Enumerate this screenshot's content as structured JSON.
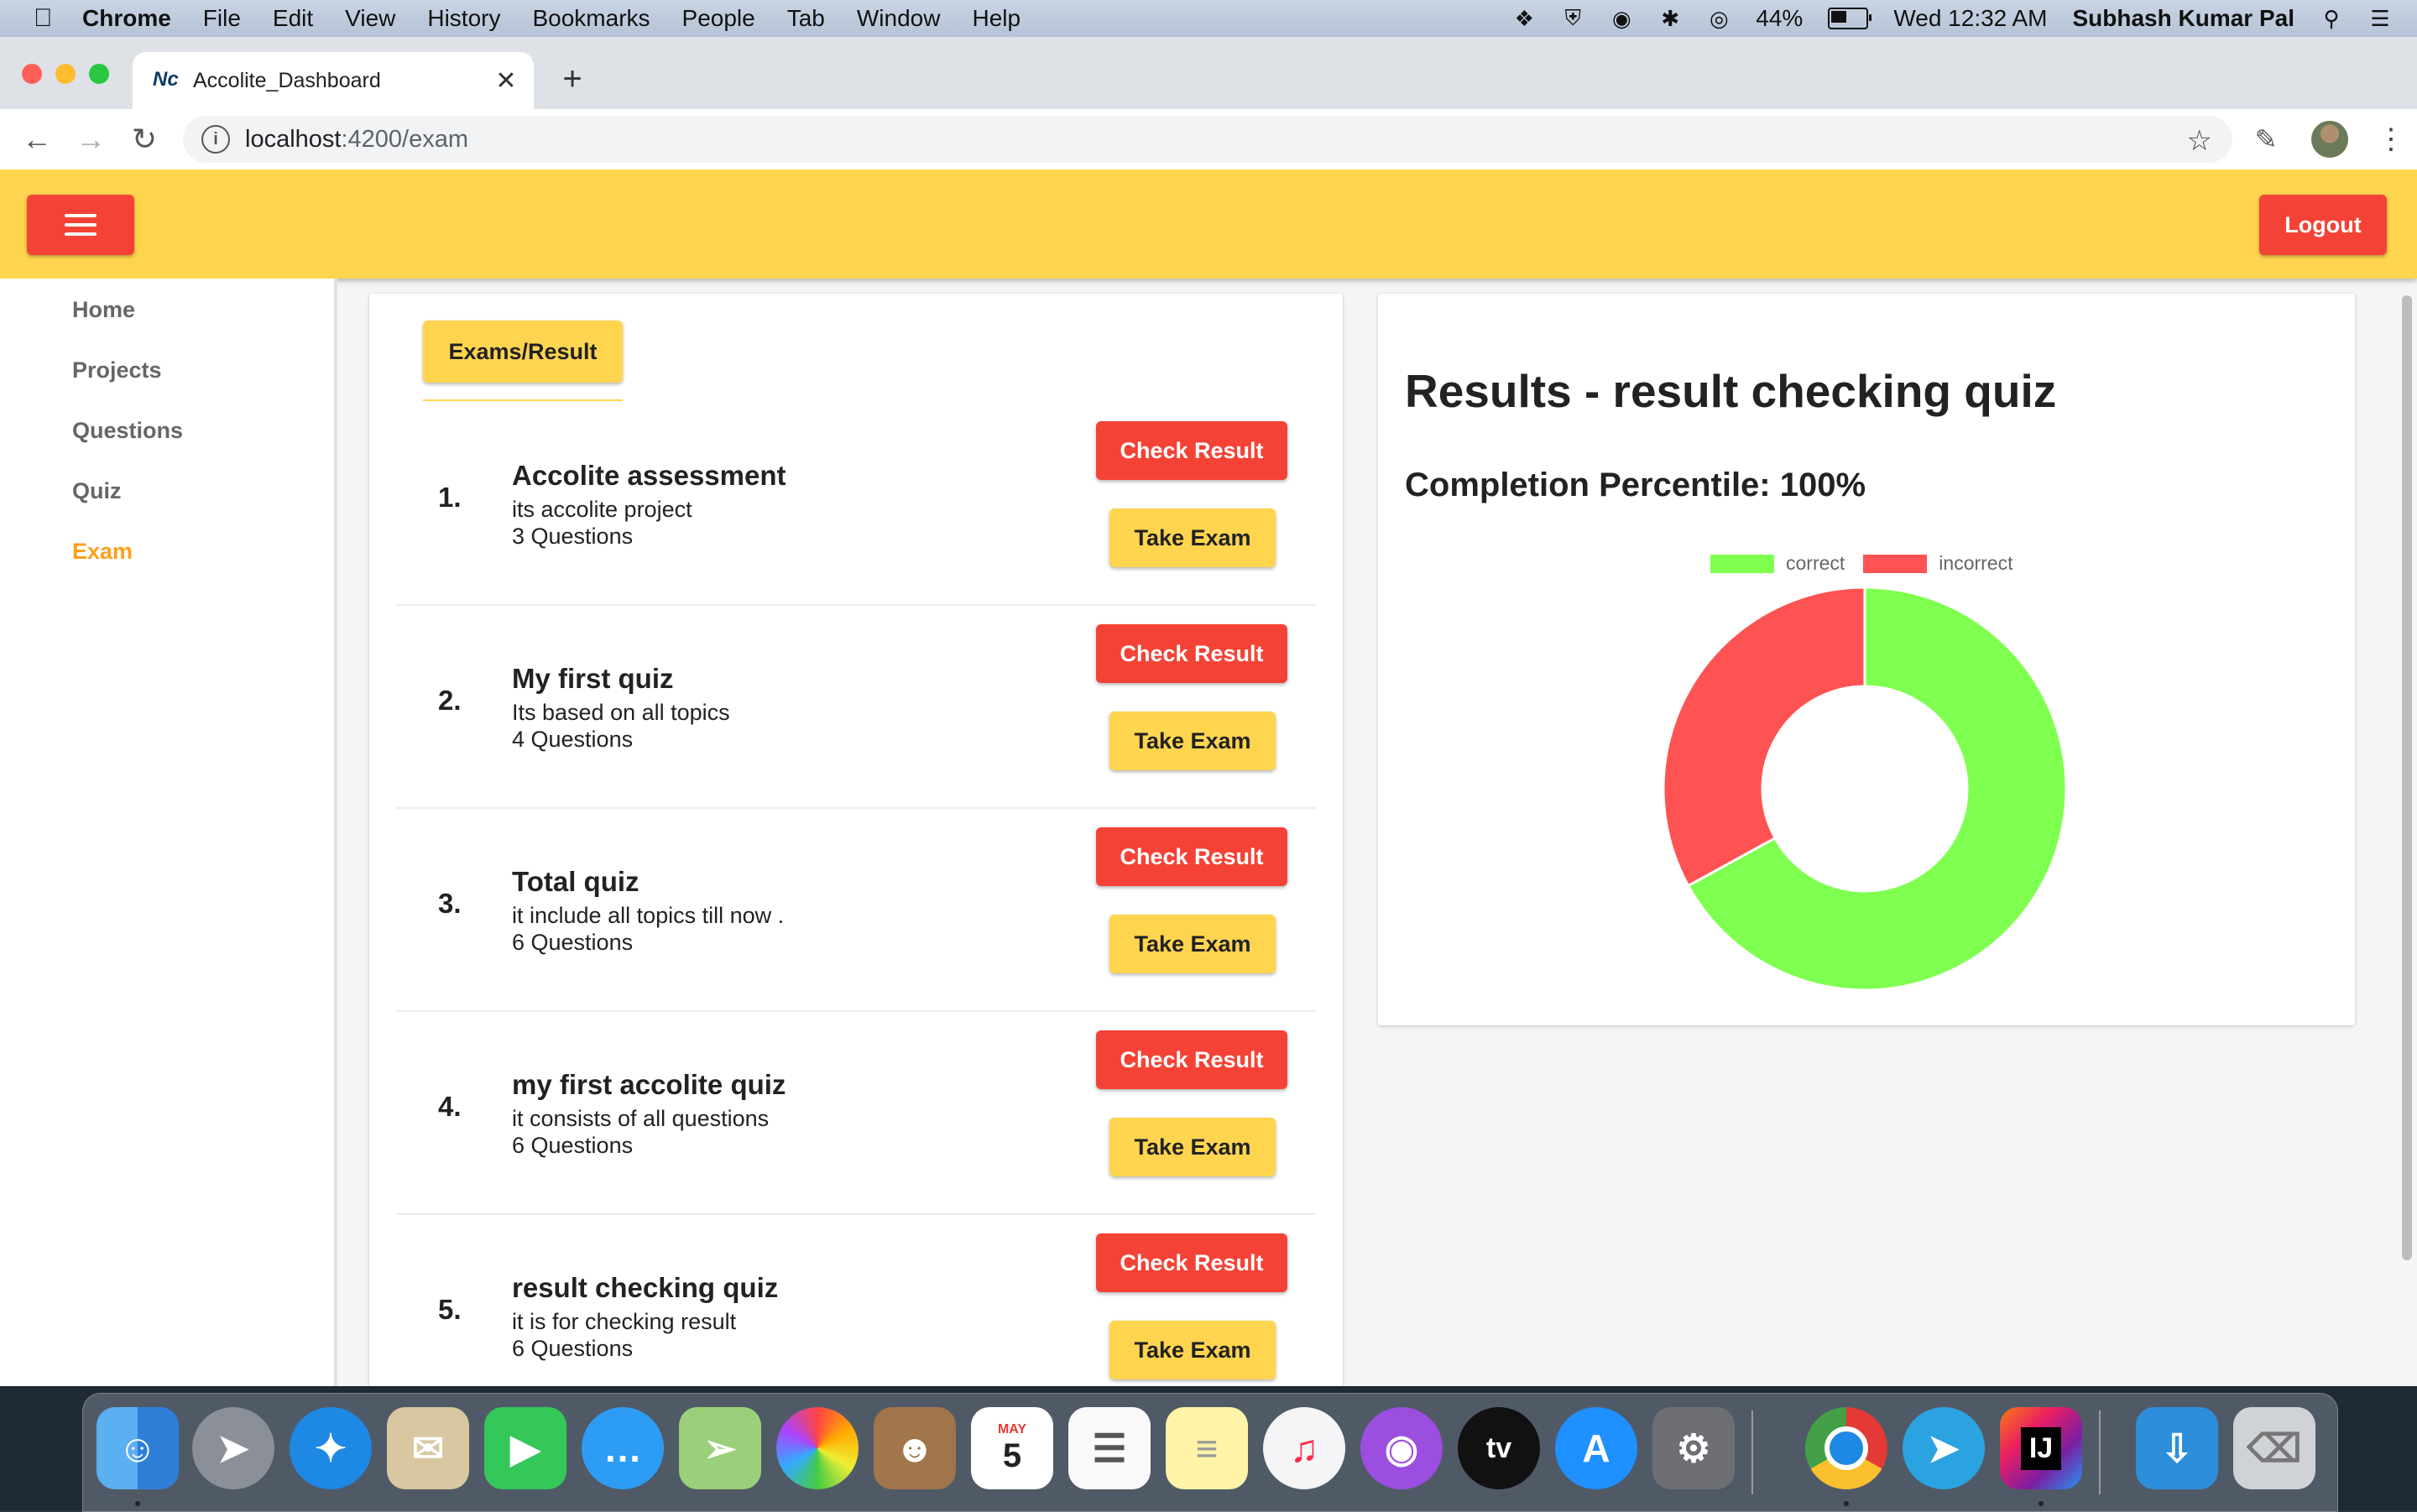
{
  "menubar": {
    "items": [
      "Chrome",
      "File",
      "Edit",
      "View",
      "History",
      "Bookmarks",
      "People",
      "Tab",
      "Window",
      "Help"
    ],
    "battery_percent": "44%",
    "battery_level": 0.44,
    "clock": "Wed 12:32 AM",
    "user": "Subhash Kumar Pal"
  },
  "browser": {
    "tab_title": "Accolite_Dashboard",
    "favicon_text": "Nc",
    "url_host": "localhost",
    "url_path": ":4200/exam"
  },
  "app": {
    "logout_label": "Logout",
    "sidebar": [
      "Home",
      "Projects",
      "Questions",
      "Quiz",
      "Exam"
    ],
    "active_nav": "Exam",
    "exams_button": "Exams/Result",
    "check_label": "Check Result",
    "take_label": "Take Exam",
    "exams": [
      {
        "num": "1.",
        "name": "Accolite assessment",
        "desc": "its accolite project",
        "count": "3 Questions"
      },
      {
        "num": "2.",
        "name": "My first quiz",
        "desc": "Its based on all topics",
        "count": "4 Questions"
      },
      {
        "num": "3.",
        "name": "Total quiz",
        "desc": "it include all topics till now .",
        "count": "6 Questions"
      },
      {
        "num": "4.",
        "name": "my first accolite quiz",
        "desc": "it consists of all questions",
        "count": "6 Questions"
      },
      {
        "num": "5.",
        "name": "result checking quiz",
        "desc": "it is for checking result",
        "count": "6 Questions"
      }
    ],
    "results_title": "Results - result checking quiz",
    "completion": "Completion Percentile: 100%"
  },
  "chart_data": {
    "type": "pie",
    "donut": true,
    "labels": [
      "correct",
      "incorrect"
    ],
    "values": [
      67,
      33
    ],
    "colors": [
      "#7fff50",
      "#ff5252"
    ],
    "legend": "top"
  },
  "dock": {
    "apps": [
      "Finder",
      "Launchpad",
      "Safari",
      "Mail",
      "FaceTime",
      "Messages",
      "Maps",
      "Photos",
      "Contacts",
      "Calendar",
      "Reminders",
      "Notes",
      "Music",
      "Podcasts",
      "TV",
      "App Store",
      "System Preferences",
      "Chrome",
      "Telegram",
      "IntelliJ IDEA",
      "Downloads",
      "Trash"
    ],
    "calendar_month": "MAY",
    "calendar_day": "5",
    "tv_label": "tv",
    "ij_label": "IJ"
  }
}
